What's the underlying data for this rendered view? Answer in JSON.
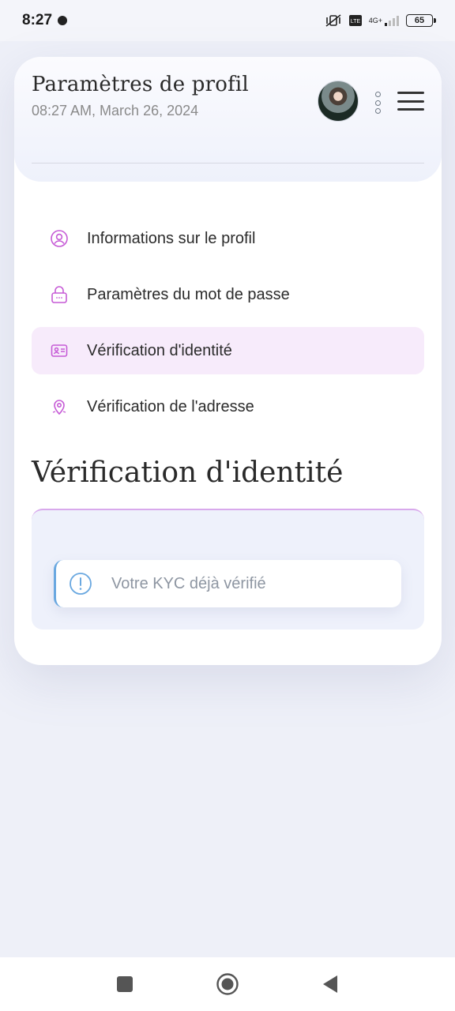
{
  "status_bar": {
    "time": "8:27",
    "battery": "65",
    "network": "4G+"
  },
  "header": {
    "title": "Paramètres de profil",
    "datetime": "08:27 AM, March 26, 2024"
  },
  "menu": {
    "items": [
      {
        "label": "Informations sur le profil",
        "icon": "user-circle-icon",
        "active": false
      },
      {
        "label": "Paramètres du mot de passe",
        "icon": "lock-icon",
        "active": false
      },
      {
        "label": "Vérification d'identité",
        "icon": "id-card-icon",
        "active": true
      },
      {
        "label": "Vérification de l'adresse",
        "icon": "map-pin-icon",
        "active": false
      }
    ]
  },
  "section": {
    "title": "Vérification d'identité",
    "alert_text": "Votre KYC déjà vérifié"
  },
  "colors": {
    "accent": "#c65bd6",
    "active_bg": "#f7ebfb",
    "info": "#6aa8e0"
  }
}
